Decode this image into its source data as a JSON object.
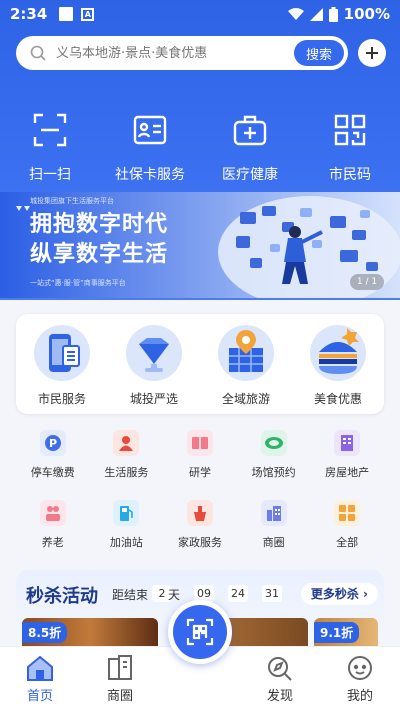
{
  "status_bar": {
    "time": "2:34",
    "battery": "100%"
  },
  "search": {
    "placeholder": "义乌本地游·景点·美食优惠",
    "button_label": "搜索"
  },
  "quick_actions": [
    {
      "label": "扫一扫",
      "icon": "scan-icon"
    },
    {
      "label": "社保卡服务",
      "icon": "id-card-icon"
    },
    {
      "label": "医疗健康",
      "icon": "medical-kit-icon"
    },
    {
      "label": "市民码",
      "icon": "qr-code-icon"
    }
  ],
  "banner": {
    "small_text": "城投集团旗下生活服务平台",
    "headline_1": "拥抱数字时代",
    "headline_2": "纵享数字生活",
    "tagline": "一站式“惠·服·管”商事服务平台",
    "pager": "1 / 1"
  },
  "featured": [
    {
      "label": "市民服务",
      "icon": "citizen-service-icon"
    },
    {
      "label": "城投严选",
      "icon": "diamond-icon"
    },
    {
      "label": "全域旅游",
      "icon": "city-map-icon"
    },
    {
      "label": "美食优惠",
      "icon": "burger-icon"
    }
  ],
  "services_row1": [
    {
      "label": "停车缴费",
      "icon": "parking-icon",
      "color": "#3f6fe8"
    },
    {
      "label": "生活服务",
      "icon": "life-service-icon",
      "color": "#e64b3c"
    },
    {
      "label": "研学",
      "icon": "book-icon",
      "color": "#f2788b"
    },
    {
      "label": "场馆预约",
      "icon": "stadium-icon",
      "color": "#2fb36b"
    },
    {
      "label": "房屋地产",
      "icon": "building-icon",
      "color": "#8a63e6"
    }
  ],
  "services_row2": [
    {
      "label": "养老",
      "icon": "elderly-icon",
      "color": "#f2788b"
    },
    {
      "label": "加油站",
      "icon": "fuel-icon",
      "color": "#27a9e6"
    },
    {
      "label": "家政服务",
      "icon": "housekeeping-icon",
      "color": "#e64b3c"
    },
    {
      "label": "商圈",
      "icon": "mall-icon",
      "color": "#6a7de8"
    },
    {
      "label": "全部",
      "icon": "all-icon",
      "color": "#f2a33a"
    }
  ],
  "flash_sale": {
    "title": "秒杀活动",
    "ends_label": "距结束",
    "days": "2",
    "days_unit": "天",
    "hours": "09",
    "minutes": "24",
    "seconds": "31",
    "more_label": "更多秒杀",
    "deal_left_badge": "8.5折",
    "deal_right_badge": "9.1折"
  },
  "tabs": [
    {
      "label": "首页",
      "icon": "home-icon",
      "active": true
    },
    {
      "label": "商圈",
      "icon": "shops-icon",
      "active": false
    },
    {
      "label": "发现",
      "icon": "discover-icon",
      "active": false
    },
    {
      "label": "我的",
      "icon": "profile-icon",
      "active": false
    }
  ],
  "colors": {
    "primary": "#2f63e6",
    "active_tab": "#2f63e6"
  }
}
